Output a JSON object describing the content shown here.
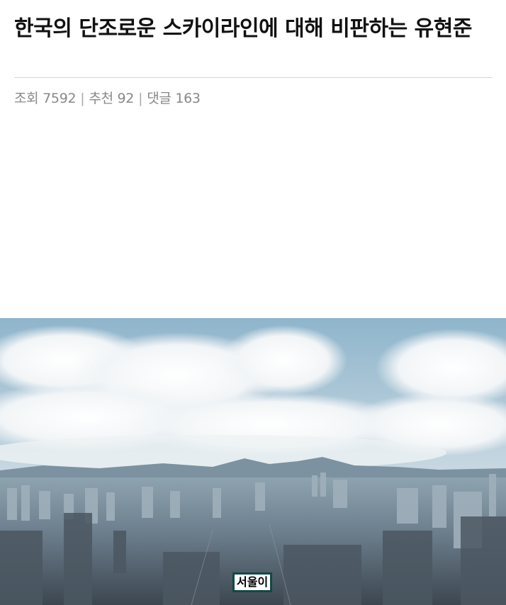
{
  "post": {
    "title": "한국의 단조로운 스카이라인에 대해 비판하는 유현준",
    "stats": {
      "views_label": "조회",
      "views": "7592",
      "likes_label": "추천",
      "likes": "92",
      "comments_label": "댓글",
      "comments": "163",
      "separator": "|"
    }
  },
  "image": {
    "subject": "city-skyline-photo",
    "caption": "서울이"
  }
}
